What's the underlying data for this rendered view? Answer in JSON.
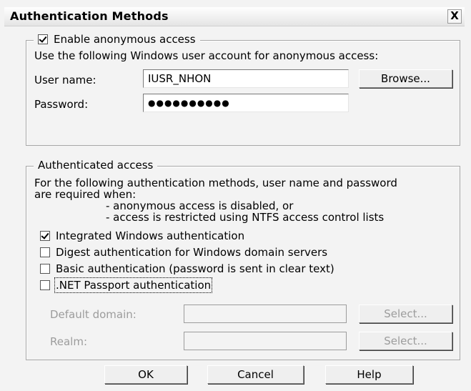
{
  "window": {
    "title": "Authentication Methods",
    "close_glyph": "X"
  },
  "anonymous": {
    "checkbox_label": "Enable anonymous access",
    "checked": true,
    "description": "Use the following Windows user account for anonymous access:",
    "username_label": "User name:",
    "username_value": "IUSR_NHON",
    "password_label": "Password:",
    "password_value": "●●●●●●●●●●",
    "browse_label": "Browse..."
  },
  "authenticated": {
    "title": "Authenticated access",
    "description_line1": "For the following authentication methods, user name and password",
    "description_line2": "are required when:",
    "bullet1": "- anonymous access is disabled, or",
    "bullet2": "- access is restricted using NTFS access control lists",
    "methods": [
      {
        "label": "Integrated Windows authentication",
        "checked": true
      },
      {
        "label": "Digest authentication for Windows domain servers",
        "checked": false
      },
      {
        "label": "Basic authentication (password is sent in clear text)",
        "checked": false
      },
      {
        "label": ".NET Passport authentication",
        "checked": false
      }
    ],
    "default_domain_label": "Default domain:",
    "realm_label": "Realm:",
    "select_label": "Select...",
    "default_domain_value": "",
    "realm_value": ""
  },
  "buttons": {
    "ok": "OK",
    "cancel": "Cancel",
    "help": "Help"
  }
}
